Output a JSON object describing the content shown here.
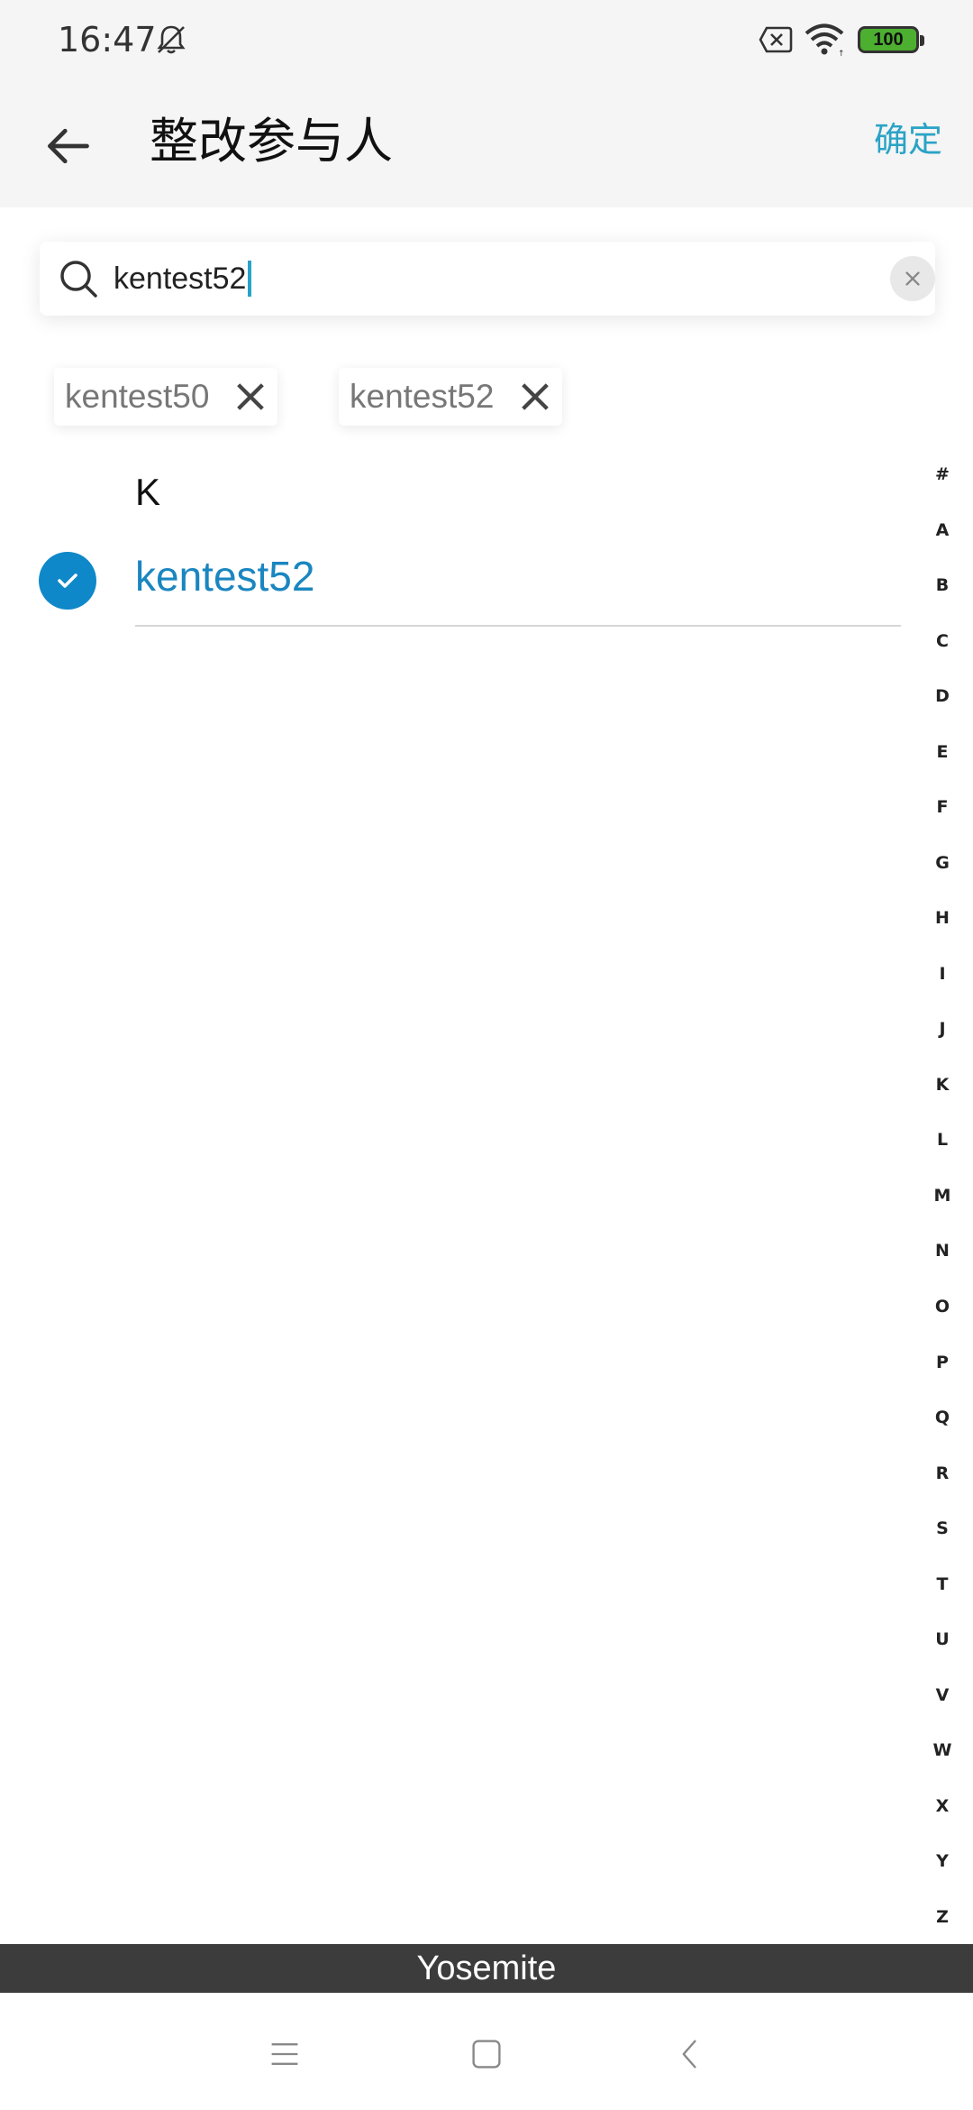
{
  "status_bar": {
    "time": "16:47",
    "battery": "100",
    "icons": [
      "bell-off-icon",
      "sim-error-icon",
      "wifi-icon",
      "battery-icon"
    ]
  },
  "header": {
    "title": "整改参与人",
    "confirm_label": "确定",
    "back_icon": "arrow-left-icon"
  },
  "search": {
    "value": "kentest52",
    "icon": "search-icon",
    "clear_icon": "close-icon"
  },
  "selected_chips": [
    {
      "label": "kentest50"
    },
    {
      "label": "kentest52"
    }
  ],
  "list": {
    "section": "K",
    "items": [
      {
        "name": "kentest52",
        "checked": true
      }
    ]
  },
  "alpha_index": [
    "#",
    "A",
    "B",
    "C",
    "D",
    "E",
    "F",
    "G",
    "H",
    "I",
    "J",
    "K",
    "L",
    "M",
    "N",
    "O",
    "P",
    "Q",
    "R",
    "S",
    "T",
    "U",
    "V",
    "W",
    "X",
    "Y",
    "Z"
  ],
  "banner": {
    "text": "Yosemite"
  },
  "colors": {
    "accent": "#2aa3c6",
    "selected_text": "#1a86c0",
    "check_fill": "#0e88c9",
    "banner_bg": "#3c3c3c"
  }
}
